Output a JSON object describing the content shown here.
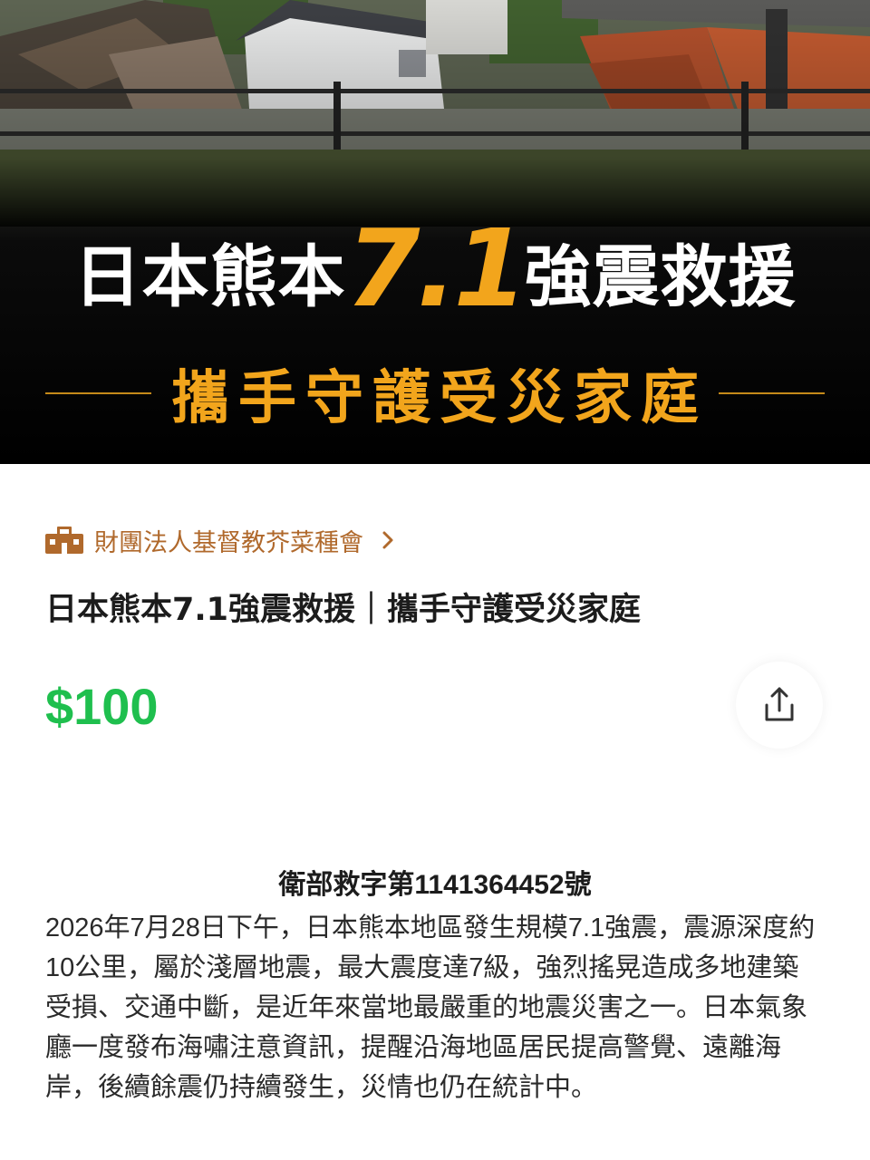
{
  "hero": {
    "title_part1": "日本熊本",
    "title_accent": "7.1",
    "title_part2": "強震救援",
    "subtitle": "攜手守護受災家庭",
    "accent_color": "#f2a51c"
  },
  "organization": {
    "name": "財團法人基督教芥菜種會",
    "icon": "organization-icon"
  },
  "campaign": {
    "title": "日本熊本7.1強震救援｜攜手守護受災家庭",
    "price": "$100",
    "price_color": "#1fbf4e"
  },
  "share": {
    "icon": "share-icon"
  },
  "description": {
    "permit": "衛部救字第1141364452號",
    "body": "2026年7月28日下午，日本熊本地區發生規模7.1強震，震源深度約10公里，屬於淺層地震，最大震度達7級，強烈搖晃造成多地建築受損、交通中斷，是近年來當地最嚴重的地震災害之一。日本氣象廳一度發布海嘯注意資訊，提醒沿海地區居民提高警覺、遠離海岸，後續餘震仍持續發生，災情也仍在統計中。"
  }
}
